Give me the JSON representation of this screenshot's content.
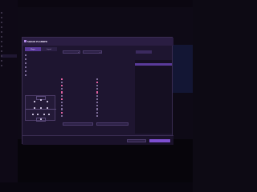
{
  "sidebar": {
    "items": [
      "",
      "",
      "",
      "",
      "",
      "",
      "",
      "",
      "",
      "",
      "",
      ""
    ],
    "active_index": 9
  },
  "modal": {
    "title": "SQUAD PLANNER",
    "tabs": [
      "Player",
      "Squad"
    ],
    "active_tab": 0,
    "left_options": [
      "",
      "",
      "",
      "",
      "",
      ""
    ],
    "left_checked": [
      0,
      0,
      1,
      0,
      0,
      0
    ],
    "pitch_label": "",
    "bottom_left_label": ""
  },
  "filters": {
    "select1_label": "",
    "select1_value": "",
    "select2_label": "",
    "select2_value": "",
    "note_lines": [
      "",
      "",
      "",
      "",
      "",
      "",
      ""
    ],
    "checkboxes": [
      "",
      "",
      "",
      "",
      "",
      "",
      "",
      "",
      "",
      "",
      "",
      "",
      "",
      "",
      "",
      "",
      "",
      "",
      "",
      "",
      "",
      "",
      "",
      ""
    ],
    "checked": [
      1,
      0,
      1,
      0,
      1,
      0,
      1,
      0,
      0,
      0,
      1,
      0,
      0,
      1,
      0,
      0,
      1,
      0,
      0,
      0,
      0,
      0,
      0,
      0
    ],
    "bottom_inputs": [
      "",
      ""
    ]
  },
  "right_panel": {
    "header": "",
    "selected_value": "",
    "options": [
      "",
      "",
      "",
      "",
      "",
      "",
      "",
      "",
      "",
      "",
      "",
      "",
      "",
      "",
      "",
      "",
      "",
      "",
      "",
      "",
      "",
      "",
      ""
    ],
    "selected_index": 1
  },
  "footer": {
    "cancel_label": "",
    "confirm_label": ""
  },
  "colors": {
    "accent": "#7d4fd0",
    "background": "#1e1530",
    "checked_box": "#c23a7a"
  }
}
